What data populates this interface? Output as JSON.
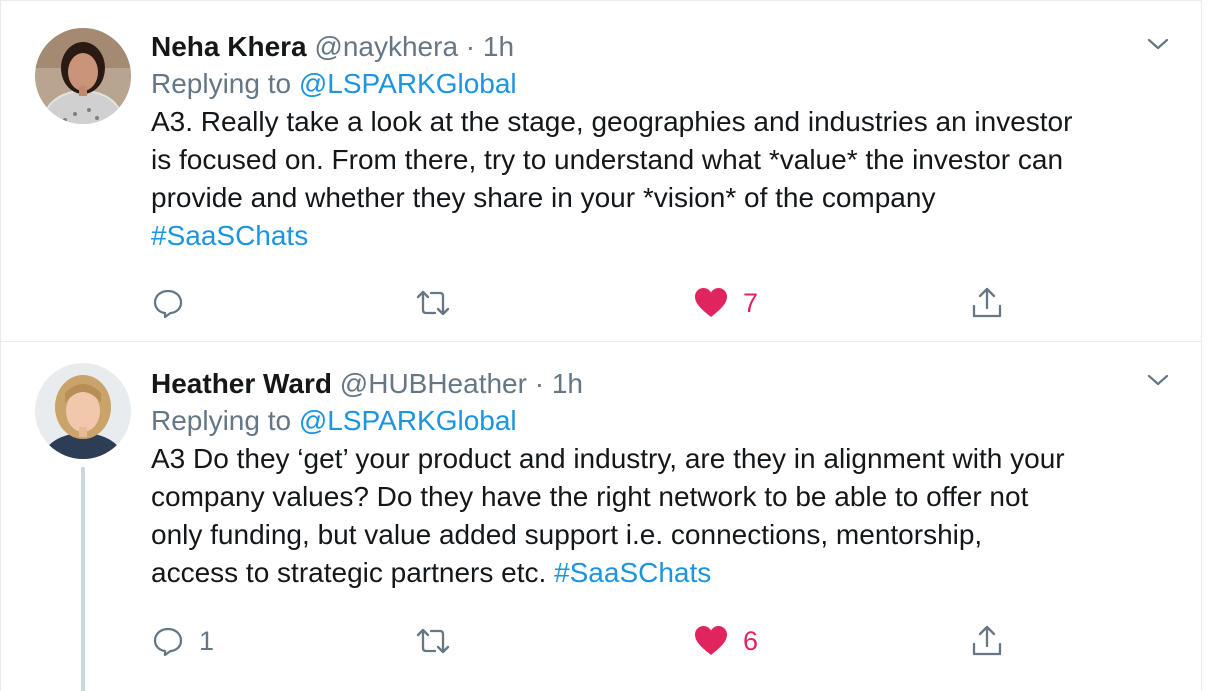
{
  "tweets": [
    {
      "name": "Neha Khera",
      "handle": "@naykhera",
      "separator": "·",
      "time": "1h",
      "replying_prefix": "Replying to",
      "replying_to": "@LSPARKGlobal",
      "text_lines": [
        "A3. Really take a look at the stage, geographies and industries an investor",
        "is focused on. From there, try to understand what *value* the investor can",
        "provide and whether they share in your *vision* of the company"
      ],
      "hashtag": "#SaaSChats",
      "reply_count": "",
      "retweet_count": "",
      "like_count": "7",
      "liked": true,
      "icons": {
        "reply": "reply-icon",
        "retweet": "retweet-icon",
        "like": "heart-icon",
        "share": "share-icon",
        "menu": "chevron-down-icon"
      }
    },
    {
      "name": "Heather Ward",
      "handle": "@HUBHeather",
      "separator": "·",
      "time": "1h",
      "replying_prefix": "Replying to",
      "replying_to": "@LSPARKGlobal",
      "text_lines": [
        "A3 Do they ‘get’ your product and industry, are they in alignment with your",
        "company values? Do they have the right network to be able to offer not",
        "only funding, but value added support i.e. connections, mentorship,",
        "access to strategic partners etc."
      ],
      "hashtag": "#SaaSChats",
      "reply_count": "1",
      "retweet_count": "",
      "like_count": "6",
      "liked": true,
      "icons": {
        "reply": "reply-icon",
        "retweet": "retweet-icon",
        "like": "heart-icon",
        "share": "share-icon",
        "menu": "chevron-down-icon"
      }
    }
  ],
  "colors": {
    "link": "#1b95e0",
    "muted": "#657786",
    "like": "#e0245e",
    "border": "#e6ecf0",
    "thread_line": "#ccd6dd"
  }
}
